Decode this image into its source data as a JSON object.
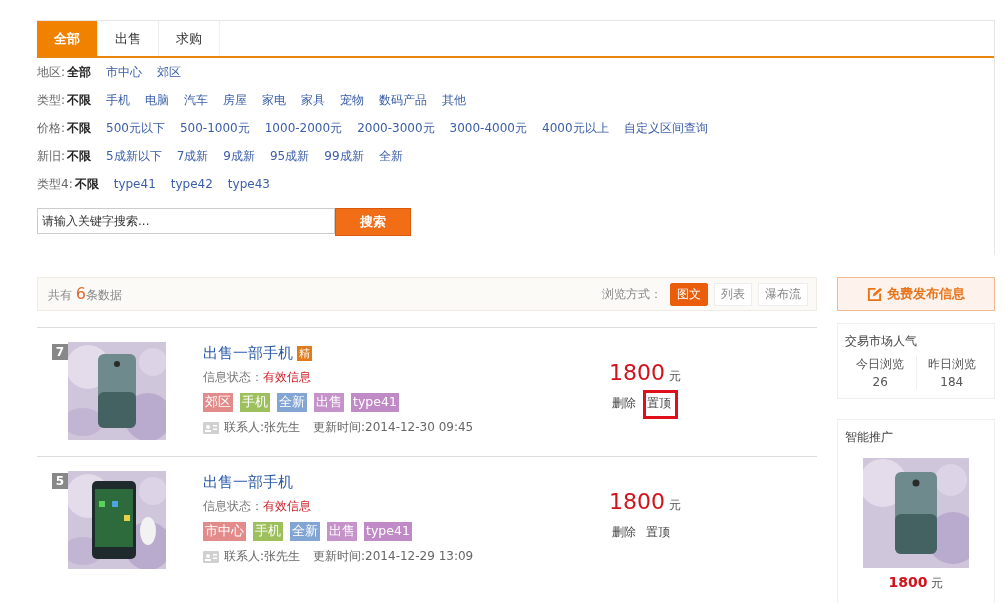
{
  "tabs": [
    {
      "label": "全部",
      "selected": true
    },
    {
      "label": "出售",
      "selected": false
    },
    {
      "label": "求购",
      "selected": false
    }
  ],
  "filters": [
    {
      "label": "地区:",
      "options": [
        {
          "text": "全部",
          "selected": true
        },
        {
          "text": "市中心",
          "selected": false
        },
        {
          "text": "郊区",
          "selected": false
        }
      ]
    },
    {
      "label": "类型:",
      "options": [
        {
          "text": "不限",
          "selected": true
        },
        {
          "text": "手机",
          "selected": false
        },
        {
          "text": "电脑",
          "selected": false
        },
        {
          "text": "汽车",
          "selected": false
        },
        {
          "text": "房屋",
          "selected": false
        },
        {
          "text": "家电",
          "selected": false
        },
        {
          "text": "家具",
          "selected": false
        },
        {
          "text": "宠物",
          "selected": false
        },
        {
          "text": "数码产品",
          "selected": false
        },
        {
          "text": "其他",
          "selected": false
        }
      ]
    },
    {
      "label": "价格:",
      "options": [
        {
          "text": "不限",
          "selected": true
        },
        {
          "text": "500元以下",
          "selected": false
        },
        {
          "text": "500-1000元",
          "selected": false
        },
        {
          "text": "1000-2000元",
          "selected": false
        },
        {
          "text": "2000-3000元",
          "selected": false
        },
        {
          "text": "3000-4000元",
          "selected": false
        },
        {
          "text": "4000元以上",
          "selected": false
        },
        {
          "text": "自定义区间查询",
          "selected": false
        }
      ]
    },
    {
      "label": "新旧:",
      "options": [
        {
          "text": "不限",
          "selected": true
        },
        {
          "text": "5成新以下",
          "selected": false
        },
        {
          "text": "7成新",
          "selected": false
        },
        {
          "text": "9成新",
          "selected": false
        },
        {
          "text": "95成新",
          "selected": false
        },
        {
          "text": "99成新",
          "selected": false
        },
        {
          "text": "全新",
          "selected": false
        }
      ]
    },
    {
      "label": "类型4:",
      "options": [
        {
          "text": "不限",
          "selected": true
        },
        {
          "text": "type41",
          "selected": false
        },
        {
          "text": "type42",
          "selected": false
        },
        {
          "text": "type43",
          "selected": false
        }
      ]
    }
  ],
  "search": {
    "placeholder": "请输入关键字搜索...",
    "button": "搜索"
  },
  "summary": {
    "prefix": "共有",
    "count": "6",
    "suffix": "条数据",
    "view_label": "浏览方式：",
    "views": [
      {
        "label": "图文",
        "selected": true
      },
      {
        "label": "列表",
        "selected": false
      },
      {
        "label": "瀑布流",
        "selected": false
      }
    ]
  },
  "listings": [
    {
      "rank": "7",
      "title": "出售一部手机",
      "badge": "精",
      "status_label": "信息状态：",
      "status": "有效信息",
      "tags": [
        {
          "text": "郊区",
          "color": "#e38b8b"
        },
        {
          "text": "手机",
          "color": "#9dbf5c"
        },
        {
          "text": "全新",
          "color": "#82a5d3"
        },
        {
          "text": "出售",
          "color": "#c593c9"
        },
        {
          "text": "type41",
          "color": "#c08ac6"
        }
      ],
      "contact": "联系人:张先生",
      "updated": "更新时间:2014-12-30 09:45",
      "price": "1800",
      "unit": "元",
      "actions": [
        {
          "label": "删除",
          "highlighted": false
        },
        {
          "label": "置顶",
          "highlighted": true
        }
      ]
    },
    {
      "rank": "5",
      "title": "出售一部手机",
      "status_label": "信息状态：",
      "status": "有效信息",
      "tags": [
        {
          "text": "市中心",
          "color": "#e38b8b"
        },
        {
          "text": "手机",
          "color": "#9dbf5c"
        },
        {
          "text": "全新",
          "color": "#82a5d3"
        },
        {
          "text": "出售",
          "color": "#c593c9"
        },
        {
          "text": "type41",
          "color": "#c08ac6"
        }
      ],
      "contact": "联系人:张先生",
      "updated": "更新时间:2014-12-29 13:09",
      "price": "1800",
      "unit": "元",
      "actions": [
        {
          "label": "删除",
          "highlighted": false
        },
        {
          "label": "置顶",
          "highlighted": false
        }
      ]
    }
  ],
  "sidebar": {
    "publish_button": "免费发布信息",
    "stats": {
      "title": "交易市场人气",
      "items": [
        {
          "label": "今日浏览",
          "value": "26"
        },
        {
          "label": "昨日浏览",
          "value": "184"
        }
      ]
    },
    "recommend": {
      "title": "智能推广",
      "price": "1800",
      "unit": "元"
    }
  }
}
